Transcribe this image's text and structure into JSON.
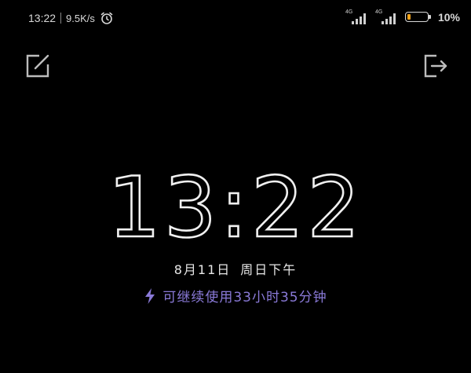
{
  "status_bar": {
    "time": "13:22",
    "net_speed": "9.5K/s",
    "signal1_label": "4G",
    "signal2_label": "4G",
    "battery_percent": "10",
    "battery_percent_unit": "%",
    "battery_level": 0.1,
    "battery_accent": "#f2a31a",
    "icons": [
      "alarm-icon",
      "signal-icon",
      "signal-icon",
      "battery-icon"
    ]
  },
  "toolbar": {
    "left_icon": "edit-icon",
    "right_icon": "exit-icon"
  },
  "lockscreen": {
    "clock_hours": "13",
    "clock_sep": ":",
    "clock_minutes": "22",
    "date": "8月11日",
    "weekday": "周日下午",
    "battery_estimate": "可继续使用33小时35分钟",
    "accent_color": "#8a7ad8",
    "battery_estimate_icon": "bolt-icon"
  }
}
